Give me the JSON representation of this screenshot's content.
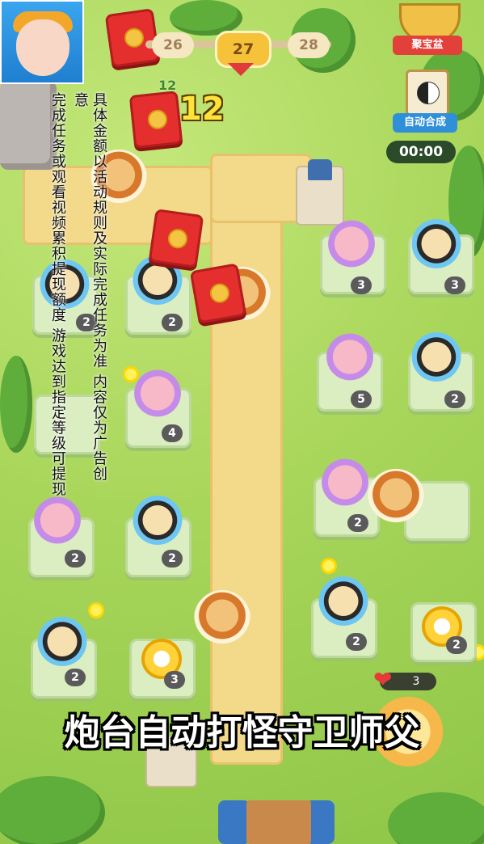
{
  "hud": {
    "stages": {
      "prev": "26",
      "current": "27",
      "next": "28"
    },
    "treasure_label": "聚宝盆",
    "auto_merge_label": "自动合成",
    "timer": "00:00",
    "wave_counter": "12",
    "wave_small": "12",
    "lives": "3"
  },
  "disclaimer": {
    "col1": "具体金额以活动规则及实际完成任务为准 内容仅为广告创意",
    "col2": "完成任务或观看视频累积提现额度 游戏达到指定等级可提现"
  },
  "caption": "炮台自动打怪守卫师父",
  "units": [
    {
      "type": "pig",
      "level": "3"
    },
    {
      "type": "guard",
      "level": "3"
    },
    {
      "type": "guard",
      "level": "2"
    },
    {
      "type": "guard",
      "level": "2"
    },
    {
      "type": "pig",
      "level": "5"
    },
    {
      "type": "guard",
      "level": "2"
    },
    {
      "type": "pig",
      "level": "4"
    },
    {
      "type": "pig",
      "level": "2"
    },
    {
      "type": "monkey",
      "level": ""
    },
    {
      "type": "pig",
      "level": "2"
    },
    {
      "type": "guard",
      "level": "2"
    },
    {
      "type": "guard",
      "level": "2"
    },
    {
      "type": "ring",
      "level": "2"
    },
    {
      "type": "guard",
      "level": "2"
    },
    {
      "type": "ring",
      "level": "3"
    },
    {
      "type": "monkey",
      "level": ""
    }
  ],
  "colors": {
    "grass": "#a8d65a",
    "path": "#f3d98a",
    "red_packet": "#e52f2f",
    "accent_gold": "#f6c23a"
  }
}
